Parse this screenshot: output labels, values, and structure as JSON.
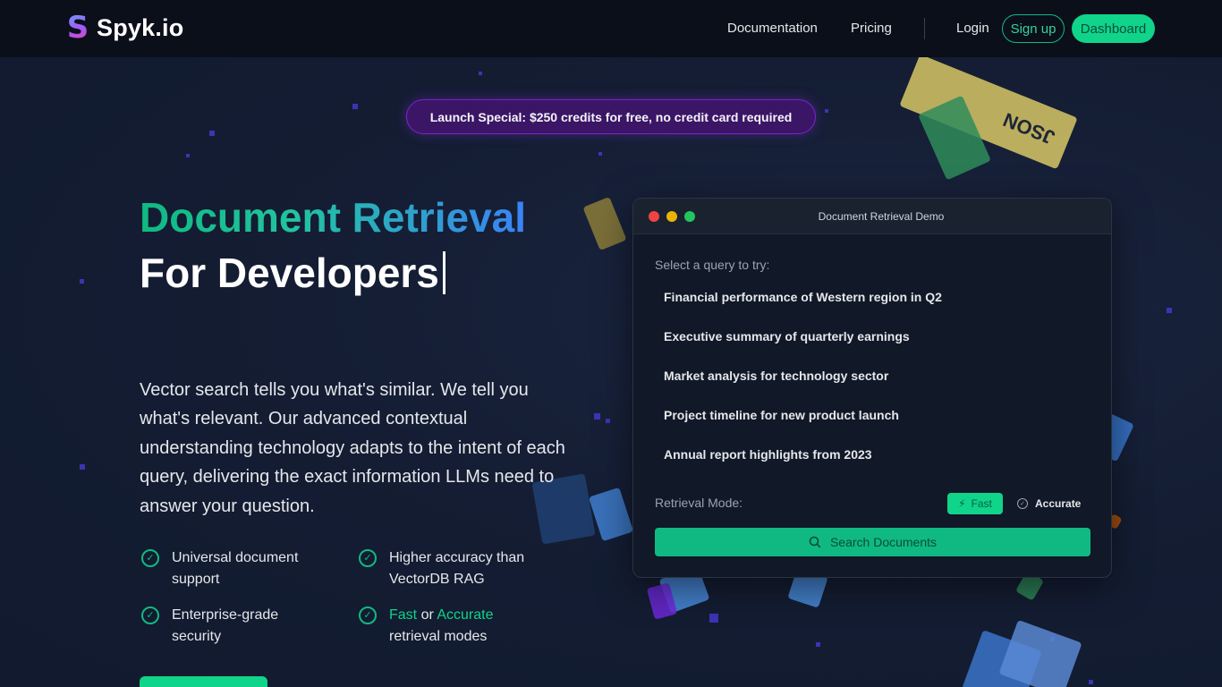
{
  "brand": {
    "name": "Spyk.io",
    "mark": "S"
  },
  "nav": {
    "documentation": "Documentation",
    "pricing": "Pricing",
    "login": "Login",
    "signup": "Sign up",
    "dashboard": "Dashboard"
  },
  "banner": "Launch Special: $250 credits for free, no credit card required",
  "hero": {
    "title_line1": "Document Retrieval",
    "title_line2": "For Developers",
    "description": "Vector search tells you what's similar. We tell you what's relevant. Our advanced contextual understanding technology adapts to the intent of each query, delivering the exact information LLMs need to answer your question."
  },
  "features": {
    "f1": "Universal document support",
    "f2": "Higher accuracy than VectorDB RAG",
    "f3": "Enterprise-grade security",
    "f4_fast": "Fast",
    "f4_or": " or ",
    "f4_accurate": "Accurate",
    "f4_rest": "retrieval modes"
  },
  "demo": {
    "title": "Document Retrieval Demo",
    "prompt": "Select a query to try:",
    "queries": [
      "Financial performance of Western region in Q2",
      "Executive summary of quarterly earnings",
      "Market analysis for technology sector",
      "Project timeline for new product launch",
      "Annual report highlights from 2023"
    ],
    "mode_label": "Retrieval Mode:",
    "mode_fast": "Fast",
    "mode_accurate": "Accurate",
    "search_button": "Search Documents"
  },
  "decor": {
    "json_label": "JSON"
  },
  "colors": {
    "accent": "#10d48a",
    "banner": "#3b1566",
    "background": "#111827"
  }
}
